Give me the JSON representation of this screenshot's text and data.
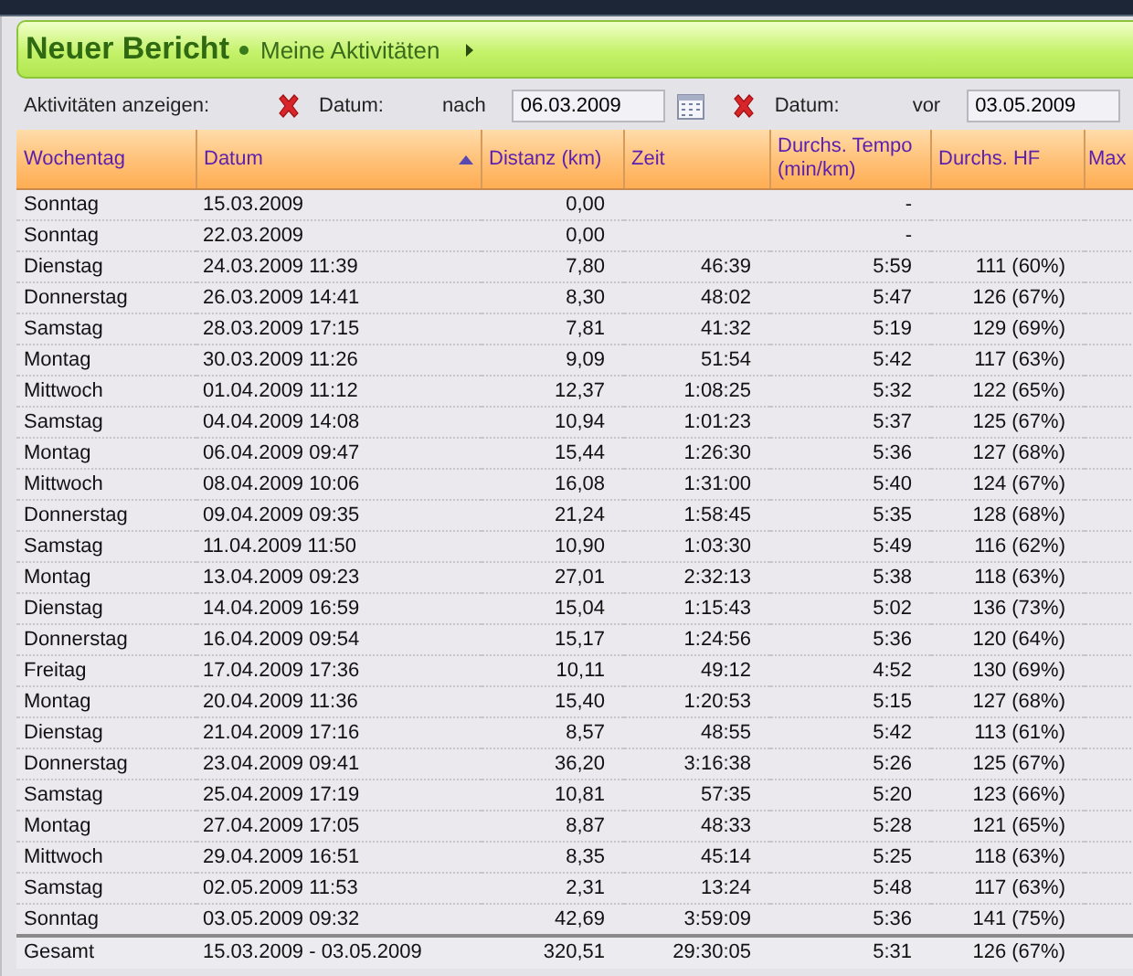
{
  "header": {
    "title": "Neuer Bericht",
    "breadcrumb": "Meine Aktivitäten"
  },
  "filter_bar": {
    "label": "Aktivitäten anzeigen:",
    "filters": [
      {
        "field": "Datum:",
        "relation": "nach",
        "value": "06.03.2009",
        "calendar": true
      },
      {
        "field": "Datum:",
        "relation": "vor",
        "value": "03.05.2009",
        "calendar": false
      }
    ]
  },
  "table": {
    "columns": [
      {
        "label": "Wochentag",
        "sorted": false
      },
      {
        "label": "Datum",
        "sorted": true
      },
      {
        "label": "Distanz (km)",
        "sorted": false
      },
      {
        "label": "Zeit",
        "sorted": false
      },
      {
        "label": "Durchs. Tempo (min/km)",
        "sorted": false
      },
      {
        "label": "Durchs. HF",
        "sorted": false
      },
      {
        "label": "Max",
        "sorted": false
      }
    ],
    "rows": [
      {
        "weekday": "Sonntag",
        "date": "15.03.2009",
        "distance": "0,00",
        "pace": "-"
      },
      {
        "weekday": "Sonntag",
        "date": "22.03.2009",
        "distance": "0,00",
        "pace": "-"
      },
      {
        "weekday": "Dienstag",
        "date": "24.03.2009 11:39",
        "distance": "7,80",
        "time": "46:39",
        "pace": "5:59",
        "hr": "111 (60%)"
      },
      {
        "weekday": "Donnerstag",
        "date": "26.03.2009 14:41",
        "distance": "8,30",
        "time": "48:02",
        "pace": "5:47",
        "hr": "126 (67%)"
      },
      {
        "weekday": "Samstag",
        "date": "28.03.2009 17:15",
        "distance": "7,81",
        "time": "41:32",
        "pace": "5:19",
        "hr": "129 (69%)"
      },
      {
        "weekday": "Montag",
        "date": "30.03.2009 11:26",
        "distance": "9,09",
        "time": "51:54",
        "pace": "5:42",
        "hr": "117 (63%)"
      },
      {
        "weekday": "Mittwoch",
        "date": "01.04.2009 11:12",
        "distance": "12,37",
        "time": "1:08:25",
        "pace": "5:32",
        "hr": "122 (65%)"
      },
      {
        "weekday": "Samstag",
        "date": "04.04.2009 14:08",
        "distance": "10,94",
        "time": "1:01:23",
        "pace": "5:37",
        "hr": "125 (67%)"
      },
      {
        "weekday": "Montag",
        "date": "06.04.2009 09:47",
        "distance": "15,44",
        "time": "1:26:30",
        "pace": "5:36",
        "hr": "127 (68%)"
      },
      {
        "weekday": "Mittwoch",
        "date": "08.04.2009 10:06",
        "distance": "16,08",
        "time": "1:31:00",
        "pace": "5:40",
        "hr": "124 (67%)"
      },
      {
        "weekday": "Donnerstag",
        "date": "09.04.2009 09:35",
        "distance": "21,24",
        "time": "1:58:45",
        "pace": "5:35",
        "hr": "128 (68%)"
      },
      {
        "weekday": "Samstag",
        "date": "11.04.2009 11:50",
        "distance": "10,90",
        "time": "1:03:30",
        "pace": "5:49",
        "hr": "116 (62%)"
      },
      {
        "weekday": "Montag",
        "date": "13.04.2009 09:23",
        "distance": "27,01",
        "time": "2:32:13",
        "pace": "5:38",
        "hr": "118 (63%)"
      },
      {
        "weekday": "Dienstag",
        "date": "14.04.2009 16:59",
        "distance": "15,04",
        "time": "1:15:43",
        "pace": "5:02",
        "hr": "136 (73%)"
      },
      {
        "weekday": "Donnerstag",
        "date": "16.04.2009 09:54",
        "distance": "15,17",
        "time": "1:24:56",
        "pace": "5:36",
        "hr": "120 (64%)"
      },
      {
        "weekday": "Freitag",
        "date": "17.04.2009 17:36",
        "distance": "10,11",
        "time": "49:12",
        "pace": "4:52",
        "hr": "130 (69%)"
      },
      {
        "weekday": "Montag",
        "date": "20.04.2009 11:36",
        "distance": "15,40",
        "time": "1:20:53",
        "pace": "5:15",
        "hr": "127 (68%)"
      },
      {
        "weekday": "Dienstag",
        "date": "21.04.2009 17:16",
        "distance": "8,57",
        "time": "48:55",
        "pace": "5:42",
        "hr": "113 (61%)"
      },
      {
        "weekday": "Donnerstag",
        "date": "23.04.2009 09:41",
        "distance": "36,20",
        "time": "3:16:38",
        "pace": "5:26",
        "hr": "125 (67%)"
      },
      {
        "weekday": "Samstag",
        "date": "25.04.2009 17:19",
        "distance": "10,81",
        "time": "57:35",
        "pace": "5:20",
        "hr": "123 (66%)"
      },
      {
        "weekday": "Montag",
        "date": "27.04.2009 17:05",
        "distance": "8,87",
        "time": "48:33",
        "pace": "5:28",
        "hr": "121 (65%)"
      },
      {
        "weekday": "Mittwoch",
        "date": "29.04.2009 16:51",
        "distance": "8,35",
        "time": "45:14",
        "pace": "5:25",
        "hr": "118 (63%)"
      },
      {
        "weekday": "Samstag",
        "date": "02.05.2009 11:53",
        "distance": "2,31",
        "time": "13:24",
        "pace": "5:48",
        "hr": "117 (63%)"
      },
      {
        "weekday": "Sonntag",
        "date": "03.05.2009 09:32",
        "distance": "42,69",
        "time": "3:59:09",
        "pace": "5:36",
        "hr": "141 (75%)"
      }
    ],
    "total": {
      "weekday": "Gesamt",
      "date": "15.03.2009 - 03.05.2009",
      "distance": "320,51",
      "time": "29:30:05",
      "pace": "5:31",
      "hr": "126 (67%)"
    }
  }
}
